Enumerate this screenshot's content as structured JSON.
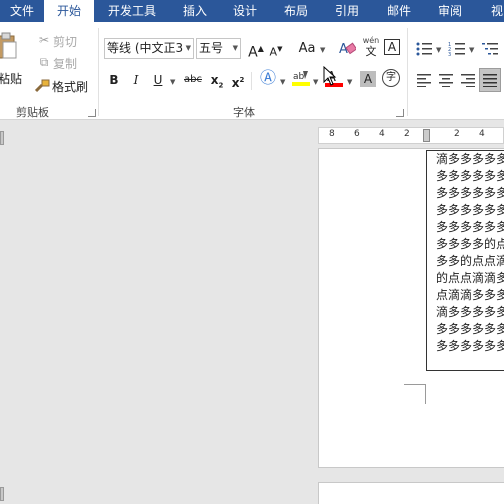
{
  "tabs": {
    "file": "文件",
    "home": "开始",
    "developer": "开发工具",
    "insert": "插入",
    "design": "设计",
    "layout": "布局",
    "references": "引用",
    "mailings": "邮件",
    "review": "审阅",
    "view": "视"
  },
  "clipboard": {
    "paste_label": "粘贴",
    "cut_label": "剪切",
    "copy_label": "复制",
    "format_painter_label": "格式刷",
    "group_label": "剪贴板"
  },
  "font": {
    "font_name": "等线 (中文正3",
    "font_size": "五号",
    "group_label": "字体",
    "grow_label": "A",
    "shrink_label": "A",
    "case_label": "Aa",
    "phonetic_label": "wén",
    "phonetic_char": "文",
    "bold": "B",
    "italic": "I",
    "underline": "U",
    "strike": "abc",
    "subscript": "x",
    "superscript": "x",
    "sub_mark": "2",
    "sup_mark": "2",
    "char_border": "A",
    "char_shade": "A",
    "enclose": "字"
  },
  "ruler": {
    "labels": [
      "8",
      "6",
      "4",
      "2",
      "2",
      "4"
    ]
  },
  "document": {
    "textbox_lines": [
      "滴多多多多多",
      "多多多多多多",
      "多多多多多多",
      "多多多多多多",
      "多多多多多多",
      "多多多多的点",
      "多多的点点滴",
      "的点点滴滴多",
      "点滴滴多多多",
      "滴多多多多多",
      "多多多多多多",
      "多多多多多多"
    ]
  },
  "colors": {
    "accent": "#2b579a",
    "highlight": "#ffff00",
    "font_color": "#ff0000"
  }
}
